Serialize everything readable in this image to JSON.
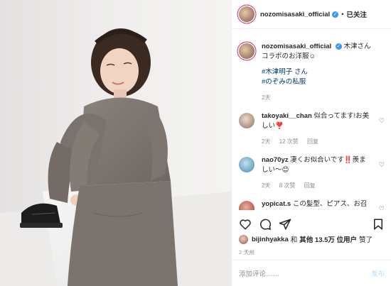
{
  "header": {
    "username": "nozomisasaki_official",
    "separator": "•",
    "follow_label": "已关注"
  },
  "caption": {
    "username": "nozomisasaki_official",
    "text": "木津さんコラボのお洋服☺︎",
    "tags": [
      "#木津明子 さん",
      "#のぞみの私服"
    ],
    "time": "2天"
  },
  "comments": [
    {
      "username": "takoyaki__chan",
      "text": "似合ってます!お美しい❣️",
      "time": "2天",
      "likes": "12 次赞",
      "reply": "回复"
    },
    {
      "username": "nao70yz",
      "text": "凄くお似合いです‼️羨ましい〜😊",
      "time": "2天",
      "likes": "8 次赞",
      "reply": "回复"
    },
    {
      "username": "yopicat.s",
      "text": "この髪型、ピアス、お召し、ヘアバンド、全部似合って",
      "time": "",
      "likes": "",
      "reply": ""
    }
  ],
  "likes": {
    "liker": "bijinhyakka",
    "text_and": "和",
    "bold_part": "其他 13.5万 位用户",
    "text_end": "赞了"
  },
  "post_time": "2 天前",
  "add_comment": {
    "placeholder": "添加评论……",
    "post_label": "发布"
  },
  "icons": [
    "verified-icon",
    "heart-icon",
    "comment-icon",
    "share-icon",
    "bookmark-icon"
  ]
}
